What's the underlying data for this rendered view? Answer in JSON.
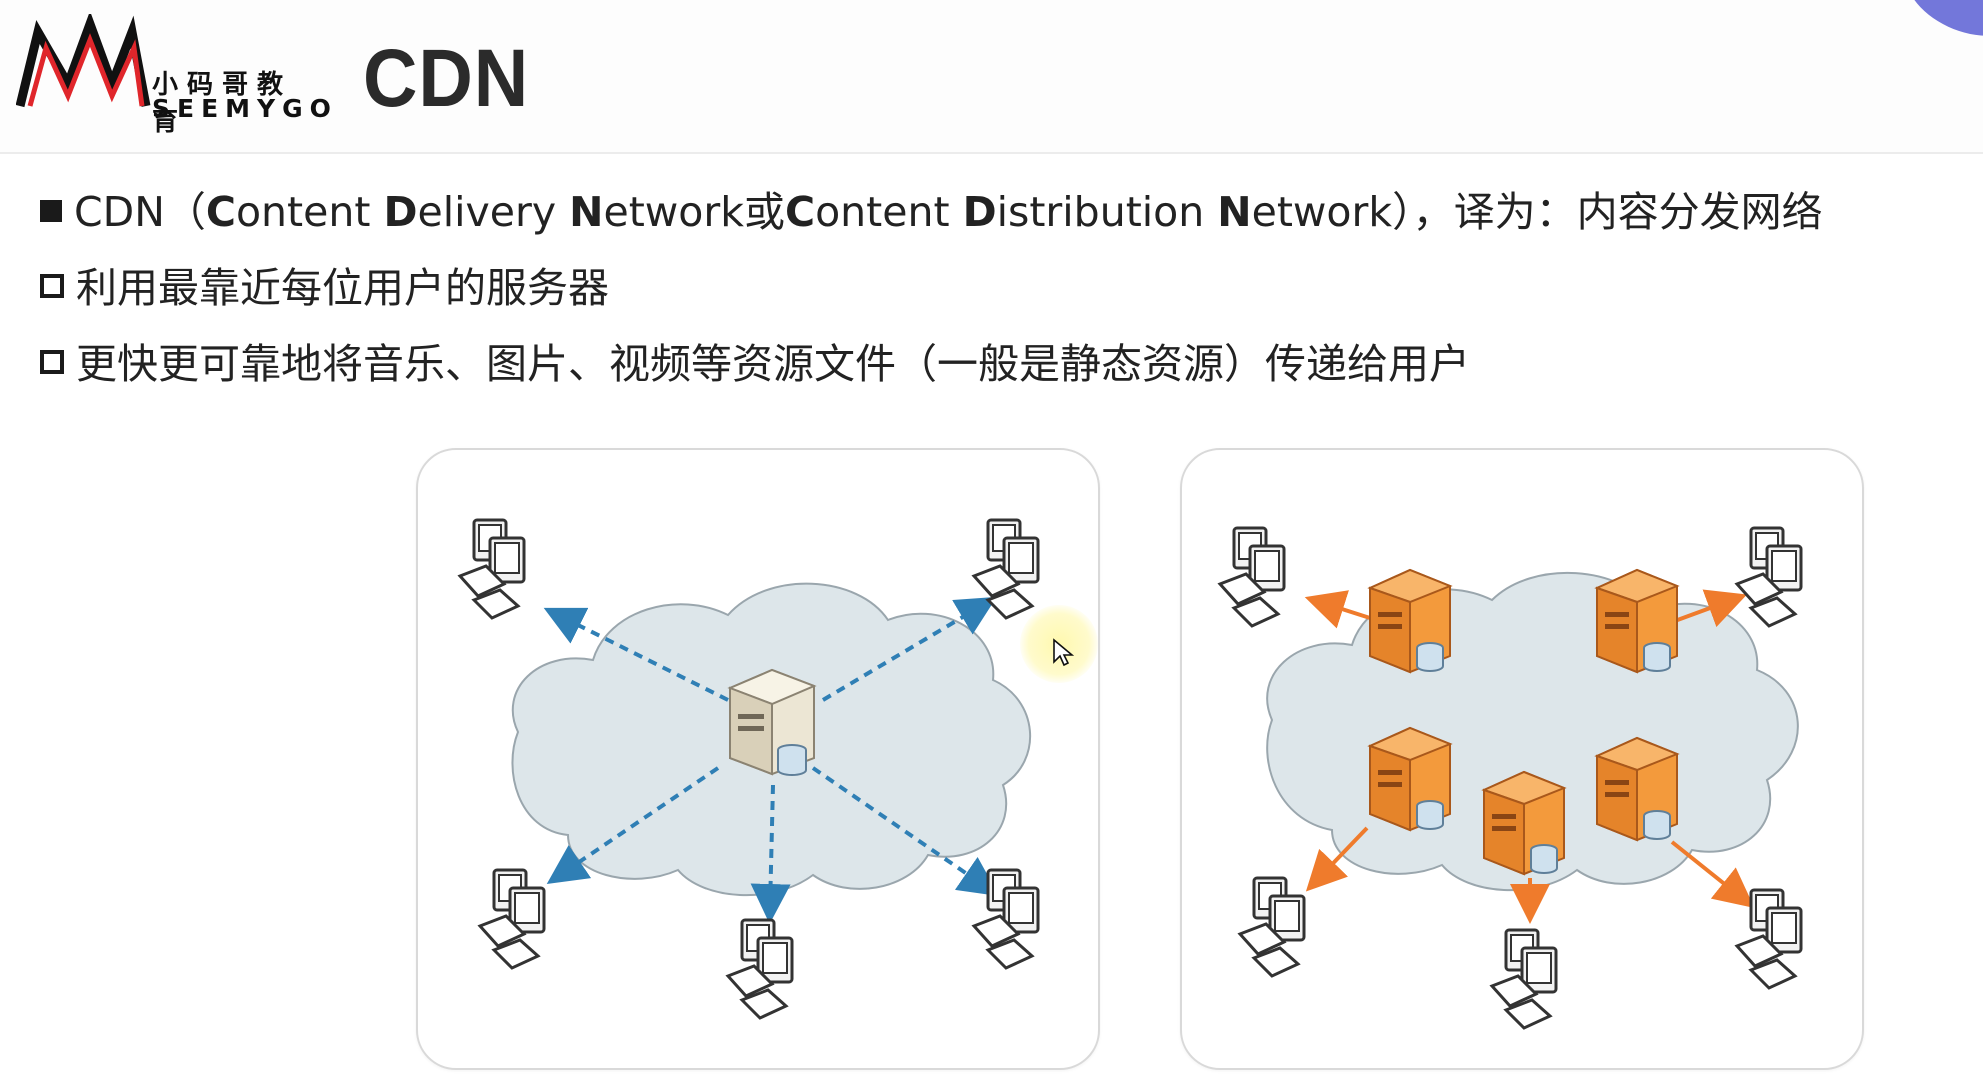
{
  "header": {
    "logo": {
      "cn_text": "小码哥教育",
      "en_text": "SEEMYGO",
      "mark": "M-logo-icon"
    },
    "title": "CDN"
  },
  "bullets": [
    {
      "marker": "filled-square",
      "prefix": "CDN（",
      "parts": [
        {
          "bold": "C",
          "rest": "ontent "
        },
        {
          "bold": "D",
          "rest": "elivery "
        },
        {
          "bold": "N",
          "rest": "etwork或"
        },
        {
          "bold": "C",
          "rest": "ontent "
        },
        {
          "bold": "D",
          "rest": "istribution "
        },
        {
          "bold": "N",
          "rest": "etwork"
        }
      ],
      "suffix": "），译为：内容分发网络"
    },
    {
      "marker": "hollow-square",
      "text": "利用最靠近每位用户的服务器"
    },
    {
      "marker": "hollow-square",
      "text": "更快更可靠地将音乐、图片、视频等资源文件（一般是静态资源）传递给用户"
    }
  ],
  "diagrams": {
    "left": {
      "cloud": "network-cloud",
      "servers": 1,
      "clients": 5,
      "arrow_color": "#2f7fb5",
      "arrow_style": "dashed"
    },
    "right": {
      "cloud": "network-cloud",
      "servers": 5,
      "clients": 5,
      "arrow_color": "#ef7b2c",
      "arrow_style": "solid"
    }
  },
  "colors": {
    "cloud_fill": "#dde6ea",
    "cloud_stroke": "#9aa6ad",
    "origin_server": "#e9e2cf",
    "edge_server": "#f39a3c"
  }
}
